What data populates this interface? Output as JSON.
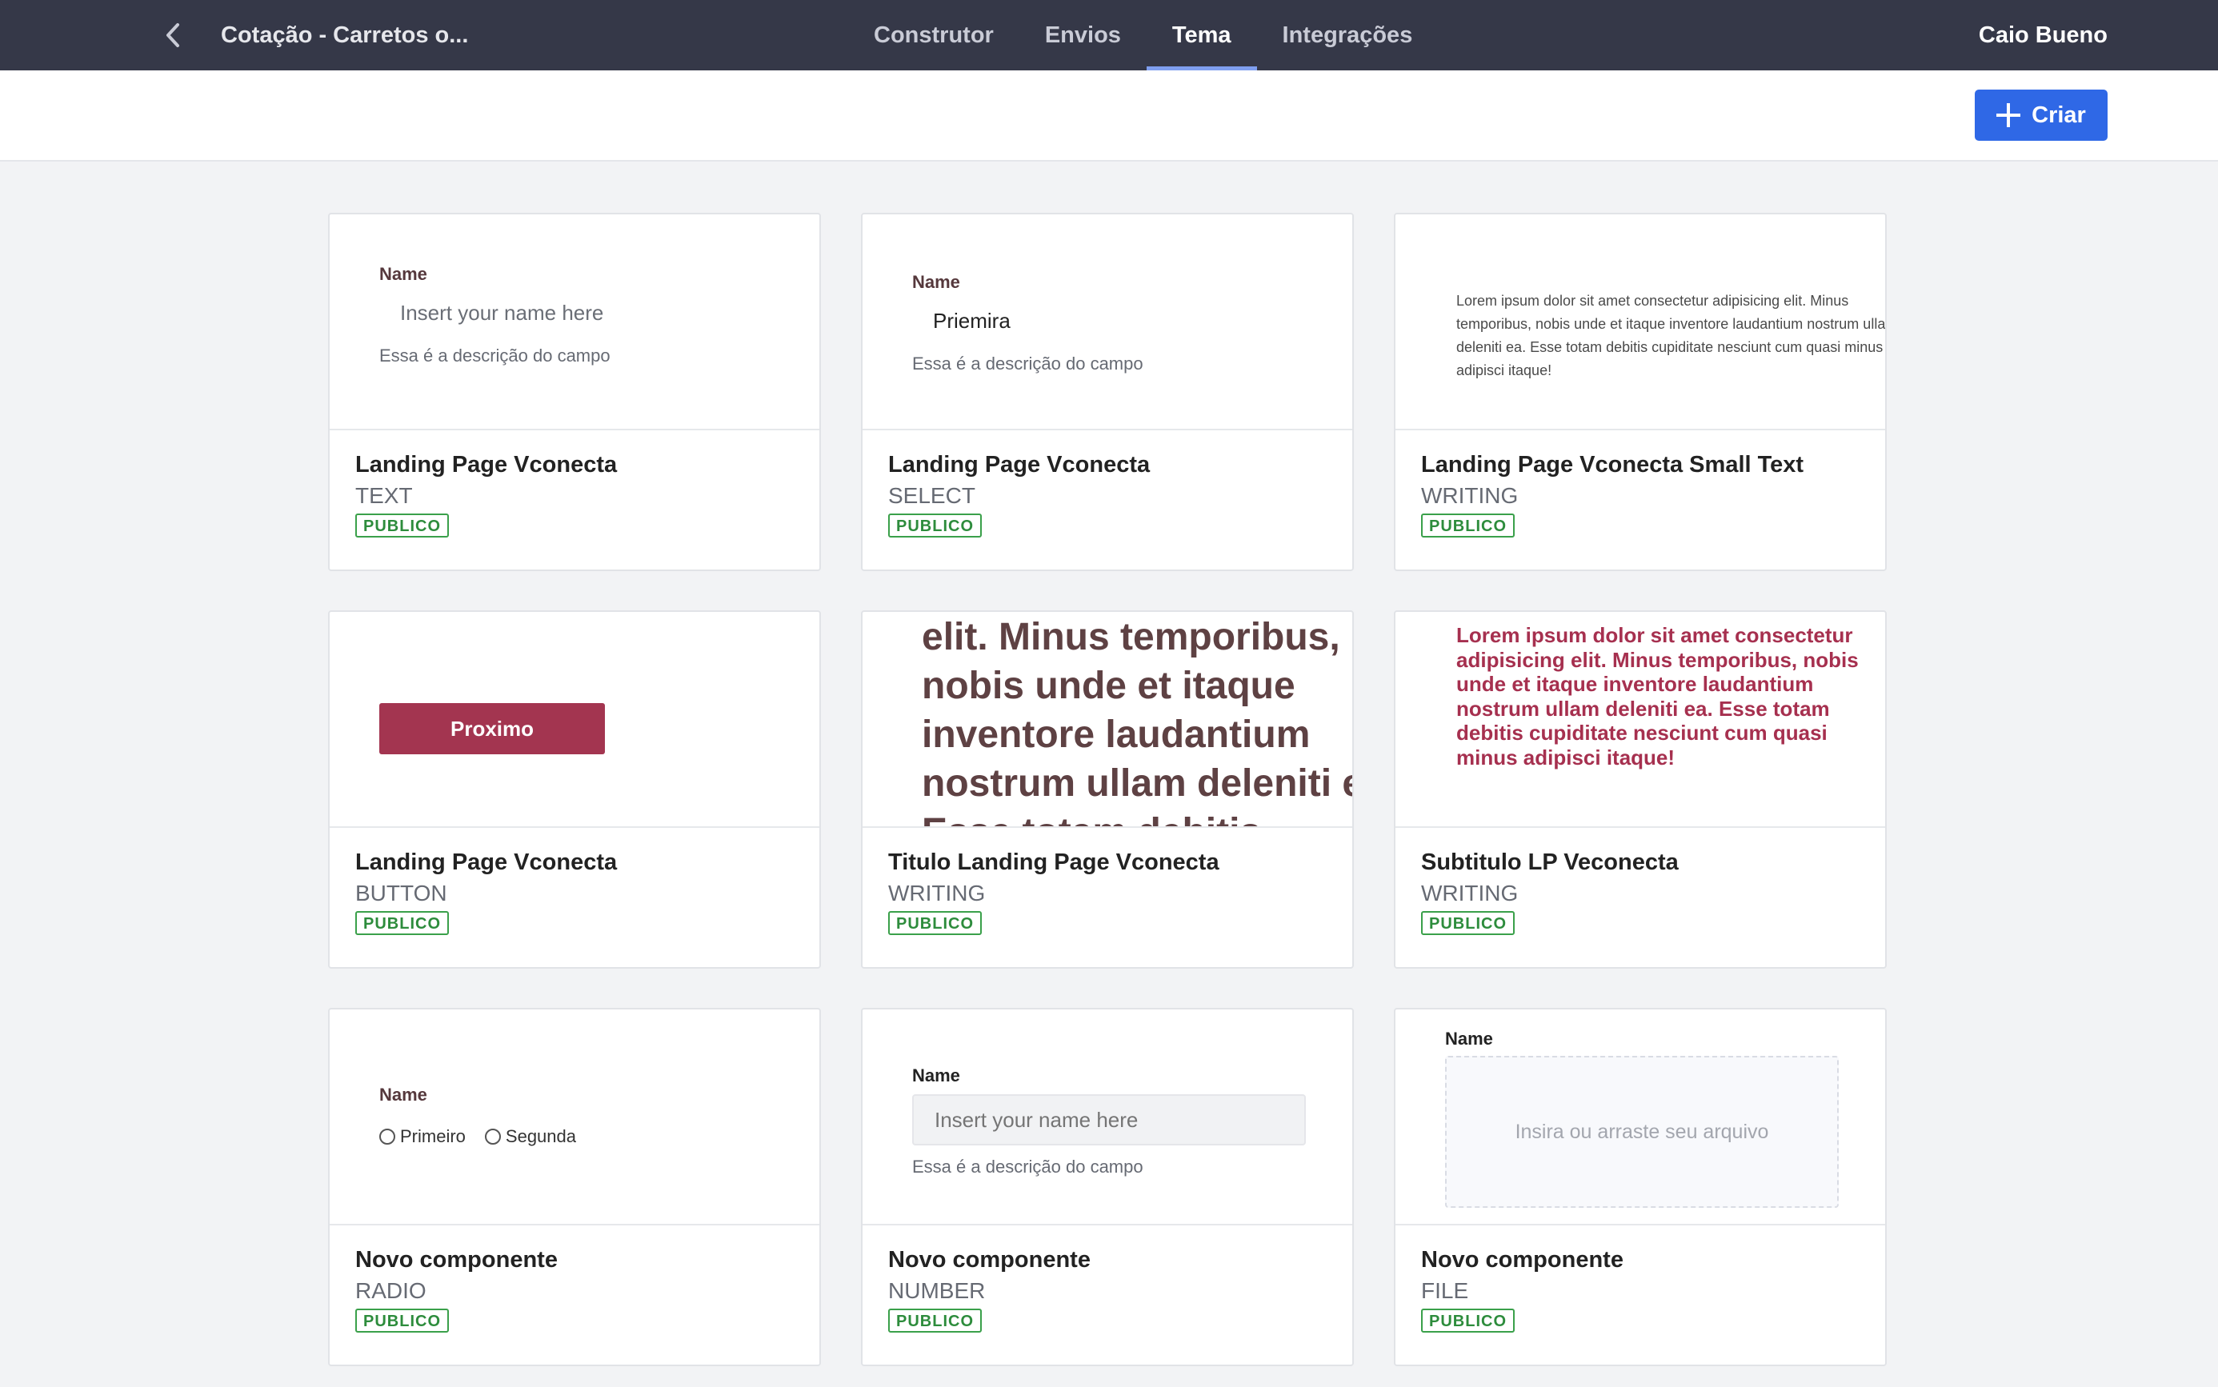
{
  "header": {
    "form_title": "Cotação - Carretos o...",
    "tabs": [
      {
        "label": "Construtor",
        "active": false
      },
      {
        "label": "Envios",
        "active": false
      },
      {
        "label": "Tema",
        "active": true
      },
      {
        "label": "Integrações",
        "active": false
      }
    ],
    "user_name": "Caio Bueno"
  },
  "toolbar": {
    "create_label": "Criar"
  },
  "colors": {
    "topbar": "#353848",
    "primary": "#2f68e6",
    "badge": "#3aa04a",
    "button_preview": "#a33550",
    "subtitle_preview": "#a6304f"
  },
  "cards": [
    {
      "name": "Landing Page Vconecta",
      "type": "TEXT",
      "badge": "PUBLICO",
      "preview": {
        "label": "Name",
        "placeholder": "Insert your name here",
        "description": "Essa é a descrição do campo"
      }
    },
    {
      "name": "Landing Page Vconecta",
      "type": "SELECT",
      "badge": "PUBLICO",
      "preview": {
        "label": "Name",
        "value": "Priemira",
        "description": "Essa é a descrição do campo"
      }
    },
    {
      "name": "Landing Page Vconecta Small Text",
      "type": "WRITING",
      "badge": "PUBLICO",
      "preview": {
        "text": "Lorem ipsum dolor sit amet consectetur adipisicing elit. Minus temporibus, nobis unde et itaque inventore laudantium nostrum ullam deleniti ea. Esse totam debitis cupiditate nesciunt cum quasi minus adipisci itaque!"
      }
    },
    {
      "name": "Landing Page Vconecta",
      "type": "BUTTON",
      "badge": "PUBLICO",
      "preview": {
        "button_label": "Proximo"
      }
    },
    {
      "name": "Titulo Landing Page Vconecta",
      "type": "WRITING",
      "badge": "PUBLICO",
      "preview": {
        "text": "consectetur adipisicing elit. Minus temporibus, nobis unde et itaque inventore laudantium nostrum ullam deleniti ea. Esse totam debitis cupiditate nesciunt cum quasi minus adipisci itaque!"
      }
    },
    {
      "name": "Subtitulo LP Veconecta",
      "type": "WRITING",
      "badge": "PUBLICO",
      "preview": {
        "text": "Lorem ipsum dolor sit amet consectetur adipisicing elit. Minus temporibus, nobis unde et itaque inventore laudantium nostrum ullam deleniti ea. Esse totam debitis cupiditate nesciunt cum quasi minus adipisci itaque!"
      }
    },
    {
      "name": "Novo componente",
      "type": "RADIO",
      "badge": "PUBLICO",
      "preview": {
        "label": "Name",
        "options": [
          "Primeiro",
          "Segunda"
        ]
      }
    },
    {
      "name": "Novo componente",
      "type": "NUMBER",
      "badge": "PUBLICO",
      "preview": {
        "label": "Name",
        "placeholder": "Insert your name here",
        "description": "Essa é a descrição do campo"
      }
    },
    {
      "name": "Novo componente",
      "type": "FILE",
      "badge": "PUBLICO",
      "preview": {
        "label": "Name",
        "dropzone": "Insira ou arraste seu arquivo"
      }
    }
  ]
}
